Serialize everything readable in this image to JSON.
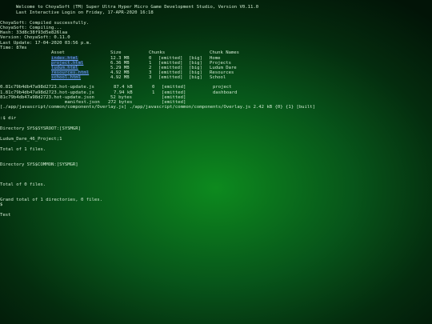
{
  "header": {
    "welcome": "Welcome to ChoyaSoft (TM) Super Ultra Hyper Micro Game Development Studio, Version V0.11.0",
    "last_login": "Last Interactive Login on Friday, 17-APR-2020 16:18"
  },
  "build": {
    "compiled": "ChoyaSoft: Compiled successfully.",
    "compiling": "ChoyaSoft: Compiling...",
    "hash": "Hash: 33d8c38f93d5e826laa",
    "version": "Version: ChoyaSoft: 0.11.0",
    "last_update": "Last Update: 17-04-2020 03:56 p.m.",
    "time": "Time: 87ms"
  },
  "asset_table": {
    "headers": {
      "asset": "Asset",
      "size": "Size",
      "chunks": "Chunks",
      "chunk_names": "Chunk Names"
    },
    "rows": [
      {
        "asset": "index.html",
        "size": "12.3 MB",
        "chunk": "0",
        "status": "[emitted]",
        "tag": "[big]",
        "name": "Home"
      },
      {
        "asset": "project.html",
        "size": "6.36 MB",
        "chunk": "1",
        "status": "[emitted]",
        "tag": "[big]",
        "name": "Projects"
      },
      {
        "asset": "ludum.html",
        "size": "5.29 MB",
        "chunk": "2",
        "status": "[emitted]",
        "tag": "[big]",
        "name": "Ludum Dare"
      },
      {
        "asset": "resources.html",
        "size": "4.92 MB",
        "chunk": "3",
        "status": "[emitted]",
        "tag": "[big]",
        "name": "Resources"
      },
      {
        "asset": "school.html",
        "size": "4.92 MB",
        "chunk": "3",
        "status": "[emitted]",
        "tag": "[big]",
        "name": "School"
      }
    ]
  },
  "hot_updates": [
    {
      "file": "0.81c79b4db47a98d2723.hot-update.js",
      "size": "87.4 kB",
      "chunk": "0",
      "status": "[emitted]",
      "name": "project"
    },
    {
      "file": "1.81c79b4db47a98d2723.hot-update.js",
      "size": "7.94 kB",
      "chunk": "1",
      "status": "[emitted]",
      "name": "dashboard"
    },
    {
      "file": "81c79b4db47a98d2723.hot-update.json",
      "size": "52 bytes",
      "chunk": "",
      "status": "[emitted]",
      "name": ""
    },
    {
      "file": "manifest.json",
      "size": "272 bytes",
      "chunk": "",
      "status": "[emitted]",
      "name": ""
    }
  ],
  "overlay_line": "[./app/javascript/common/components/Overlay.js] ./app/javascript/common/components/Overlay.js 2.42 kB {0} {1} [built]",
  "session": {
    "cmd1": ":$ dir",
    "dir1": "Directory SYS$SYSROOT:[SYSMGR]",
    "file1": "Ludum_Dare_46_Project;1",
    "total1": "Total of 1 files.",
    "dir2": "Directory SYS$COMMON:[SYSMGR]",
    "total2": "Total of 0 files.",
    "grand_total": "Grand total of 1 directories, 0 files.",
    "prompt": "$",
    "typed": "Test"
  },
  "colors": {
    "background": "#0b7a1c",
    "text": "#cfe8cf",
    "link": "#6fa6ff"
  }
}
